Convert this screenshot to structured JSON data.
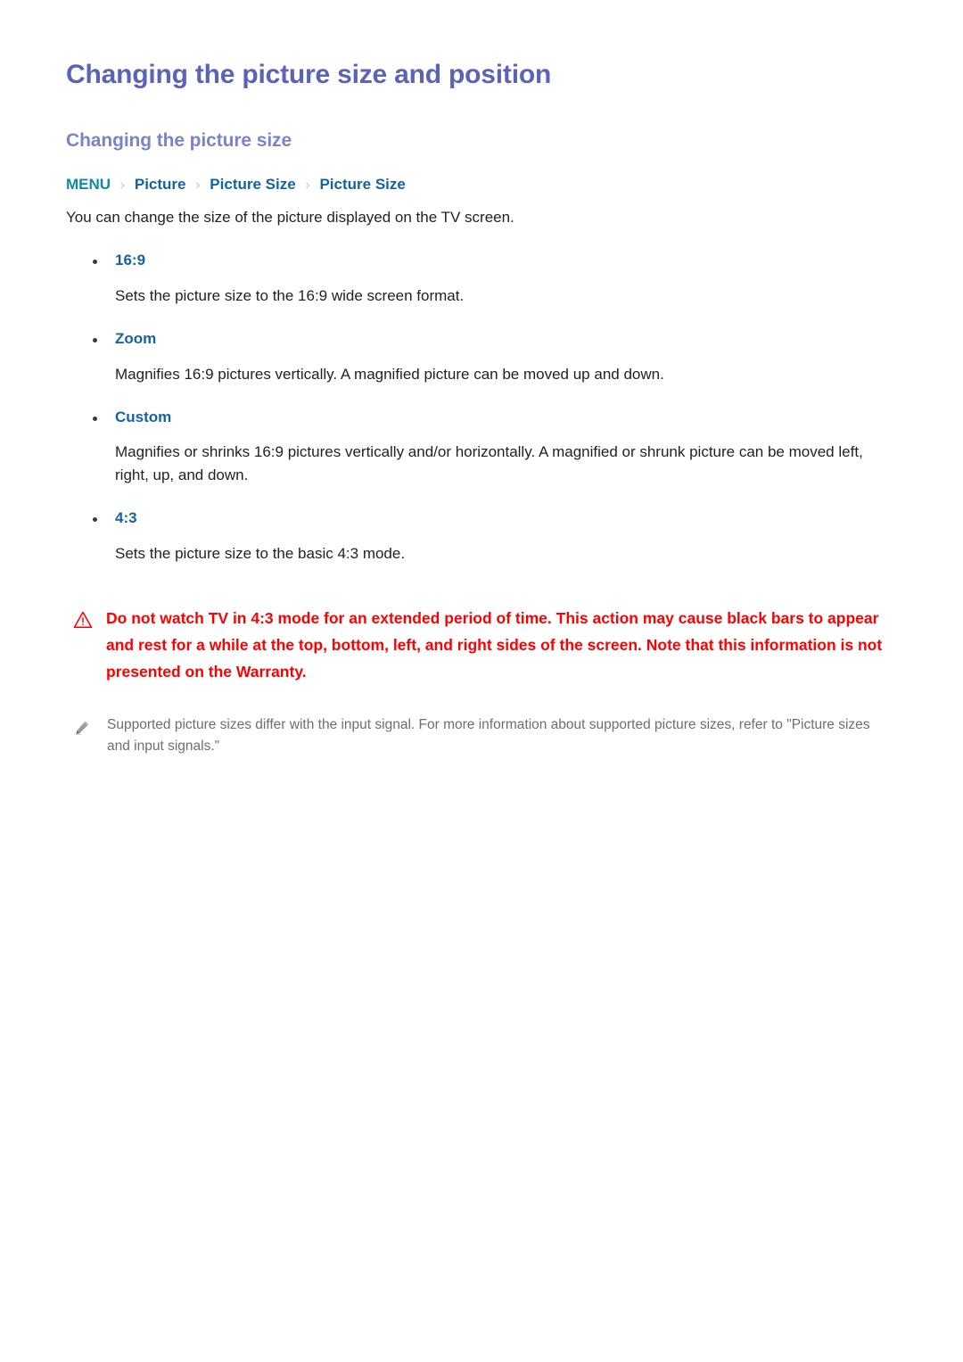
{
  "document": {
    "page_title": "Changing the picture size and position",
    "section_title": "Changing the picture size",
    "breadcrumb": {
      "root": "MENU",
      "separator": "›",
      "items": [
        "Picture",
        "Picture Size",
        "Picture Size"
      ]
    },
    "intro": "You can change the size of the picture displayed on the TV screen.",
    "options": [
      {
        "label": "16:9",
        "description": "Sets the picture size to the 16:9 wide screen format."
      },
      {
        "label": "Zoom",
        "description": "Magnifies 16:9 pictures vertically. A magnified picture can be moved up and down."
      },
      {
        "label": "Custom",
        "description": "Magnifies or shrinks 16:9 pictures vertically and/or horizontally. A magnified or shrunk picture can be moved left, right, up, and down."
      },
      {
        "label": "4:3",
        "description": "Sets the picture size to the basic 4:3 mode."
      }
    ],
    "warning": {
      "icon": "warning-triangle-icon",
      "text": "Do not watch TV in 4:3 mode for an extended period of time. This action may cause black bars to appear and rest for a while at the top, bottom, left, and right sides of the screen. Note that this information is not presented on the Warranty."
    },
    "note": {
      "icon": "pencil-icon",
      "text": "Supported picture sizes differ with the input signal. For more information about supported picture sizes, refer to \"Picture sizes and input signals.\""
    },
    "colors": {
      "page_title": "#5b63b8",
      "section_title": "#7b83c9",
      "breadcrumb_root": "#0f8ca0",
      "breadcrumb_item": "#1263a5",
      "breadcrumb_separator": "#c5c8cc",
      "option_label": "#1263a5",
      "body_text": "#231f20",
      "warning_text": "#ff0000",
      "note_text": "#6d6e71",
      "background": "#ffffff"
    }
  }
}
